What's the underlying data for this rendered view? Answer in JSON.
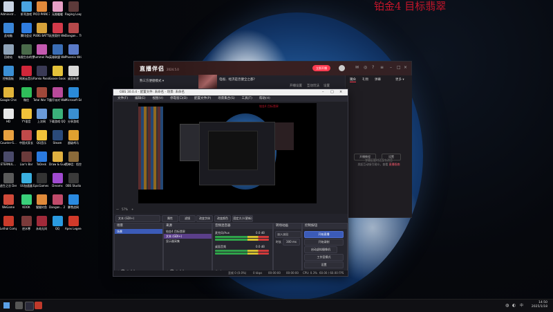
{
  "overlay": {
    "text": "铂金4 目标翡翠"
  },
  "desktop_icons": [
    {
      "label": "Administr...",
      "color": "#c9d4e4",
      "icon": "user-folder-icon"
    },
    {
      "label": "虾壳游戏",
      "color": "#4aa4e0",
      "icon": "game-icon"
    },
    {
      "label": "PICO PARK 3",
      "color": "#e28a3a",
      "icon": "game-icon"
    },
    {
      "label": "无限暖暖",
      "color": "#e7a0c6",
      "icon": "game-icon"
    },
    {
      "label": "Raging Loop",
      "color": "#5c3a3a",
      "icon": "game-icon"
    },
    {
      "label": "此电脑",
      "color": "#3a86d8",
      "icon": "computer-icon"
    },
    {
      "label": "腾讯会议",
      "color": "#2f7de1",
      "icon": "meeting-icon"
    },
    {
      "label": "PUBG BATTLEGR...",
      "color": "#d6a23a",
      "icon": "game-icon"
    },
    {
      "label": "无畏契约 WeGame版",
      "color": "#d33a4a",
      "icon": "game-icon"
    },
    {
      "label": "Dangan... Trigger H...",
      "color": "#b5484a",
      "icon": "game-icon"
    },
    {
      "label": "回收站",
      "color": "#8fa3b8",
      "icon": "recycle-bin-icon"
    },
    {
      "label": "有限生存的世界",
      "color": "#4a6a4a",
      "icon": "game-icon"
    },
    {
      "label": "Pummel Party",
      "color": "#c45ab0",
      "icon": "game-icon"
    },
    {
      "label": "英雄联盟 WeGame版",
      "color": "#3a6db5",
      "icon": "game-icon"
    },
    {
      "label": "Phoenix Wright A...",
      "color": "#5a7ac8",
      "icon": "game-icon"
    },
    {
      "label": "控制面板",
      "color": "#3b8fd4",
      "icon": "control-panel-icon"
    },
    {
      "label": "网易云音乐",
      "color": "#d0273a",
      "icon": "music-icon"
    },
    {
      "label": "Ranko Passion...",
      "color": "#3a3a55",
      "icon": "game-icon"
    },
    {
      "label": "Goose Goose Duck",
      "color": "#e4c23a",
      "icon": "game-icon"
    },
    {
      "label": "桌面新建",
      "color": "#d8d8d8",
      "icon": "file-icon"
    },
    {
      "label": "Google Chrome",
      "color": "#e0b43a",
      "icon": "chrome-icon"
    },
    {
      "label": "微信",
      "color": "#2fbe5a",
      "icon": "wechat-icon"
    },
    {
      "label": "Total War THREE K...",
      "color": "#a0483a",
      "icon": "game-icon"
    },
    {
      "label": "蛋仔派对 Wallpaper...",
      "color": "#b84a9a",
      "icon": "game-icon"
    },
    {
      "label": "Microsoft Edge",
      "color": "#2a8ad8",
      "icon": "edge-icon"
    },
    {
      "label": "HD",
      "color": "#e8e8e8",
      "icon": "file-icon"
    },
    {
      "label": "YY语音",
      "color": "#f0c23a",
      "icon": "voice-icon"
    },
    {
      "label": "上次网",
      "color": "#6a9ad8",
      "icon": "file-icon"
    },
    {
      "label": "下载游戏 QQ音乐",
      "color": "#3ab07a",
      "icon": "music-icon"
    },
    {
      "label": "分享游戏",
      "color": "#3a8fd0",
      "icon": "game-icon"
    },
    {
      "label": "Counter-S...",
      "color": "#e8a040",
      "icon": "game-icon"
    },
    {
      "label": "中国式家长",
      "color": "#c04a4a",
      "icon": "game-icon"
    },
    {
      "label": "QQ音乐",
      "color": "#f0c23a",
      "icon": "music-icon"
    },
    {
      "label": "Steam",
      "color": "#2a4a7a",
      "icon": "steam-icon"
    },
    {
      "label": "超级鸡马",
      "color": "#e0a030",
      "icon": "game-icon"
    },
    {
      "label": "ETERNUL...",
      "color": "#4a4a6a",
      "icon": "game-icon"
    },
    {
      "label": "Liar's Bar",
      "color": "#6a3a3a",
      "icon": "game-icon"
    },
    {
      "label": "ToDesk",
      "color": "#2a7ae0",
      "icon": "remote-desktop-icon"
    },
    {
      "label": "Draw & Guess - ...",
      "color": "#e0b040",
      "icon": "game-icon"
    },
    {
      "label": "黑神话：悟空",
      "color": "#8a6a3a",
      "icon": "game-icon"
    },
    {
      "label": "逃生之谷 Demo",
      "color": "#5a5a5a",
      "icon": "game-icon"
    },
    {
      "label": "UU加速器",
      "color": "#3ab0e0",
      "icon": "accelerator-icon"
    },
    {
      "label": "EpicGames Launcher",
      "color": "#333333",
      "icon": "epic-icon"
    },
    {
      "label": "Dreams",
      "color": "#a04ad0",
      "icon": "game-icon"
    },
    {
      "label": "OBS Studio",
      "color": "#3a3a3a",
      "icon": "obs-icon"
    },
    {
      "label": "WeGame",
      "color": "#d04a3a",
      "icon": "wegame-icon"
    },
    {
      "label": "KOOK",
      "color": "#3ad07a",
      "icon": "chat-icon"
    },
    {
      "label": "猫猫钓鱼",
      "color": "#e08a3a",
      "icon": "game-icon"
    },
    {
      "label": "Dangan... 2 Goodb...",
      "color": "#c04a6a",
      "icon": "game-icon"
    },
    {
      "label": "暴雪战网",
      "color": "#2a8ae0",
      "icon": "battlenet-icon"
    },
    {
      "label": "Lethal Company",
      "color": "#c83a2a",
      "icon": "game-icon"
    },
    {
      "label": "逆水寒",
      "color": "#7a3a3a",
      "icon": "game-icon"
    },
    {
      "label": "永劫无间",
      "color": "#a02a3a",
      "icon": "game-icon"
    },
    {
      "label": "QQ",
      "color": "#2a9ae0",
      "icon": "qq-icon"
    },
    {
      "label": "Apex Legends",
      "color": "#d03a2a",
      "icon": "game-icon"
    }
  ],
  "app": {
    "logo": "直播伴侣",
    "logo_sub": "2024.5.0",
    "start_btn": "立即开播",
    "stream_title": "电视、经济是否健全之都?",
    "room_tag": "熟三方便捷模式 ▾",
    "tabs": [
      "开播设置",
      "互动玩法",
      "设置"
    ],
    "tab_active": "互动",
    "sidebar_tabs": [
      "观众",
      "礼物",
      "弹幕"
    ],
    "sidebar_right": "更多 ▾",
    "empty_line1": "弹幕区暂时还没有消息",
    "empty_line2": "发起互动吸引观众，查看",
    "empty_link": "直播指南",
    "btn_left": "开播教程",
    "btn_right": "设置"
  },
  "obs": {
    "title": "OBS 30.0.4 - 配置文件: 未命名 - 场景: 未命名",
    "menu": [
      "文件(F)",
      "编辑(E)",
      "视图(V)",
      "停靠窗口(D)",
      "配置文件(P)",
      "场景集合(S)",
      "工具(T)",
      "帮助(H)"
    ],
    "toolbar_zoom": "57%",
    "controls": [
      "文本 (GDI+)",
      "属性",
      "滤镜",
      "改变字体",
      "改变颜色",
      "固定大小(更新)"
    ],
    "scenes_header": "场景",
    "scenes": [
      "场景"
    ],
    "sources_header": "来源",
    "sources": [
      "铂金4 目标翡翠",
      "文本 (GDI+)",
      "显示器采集"
    ],
    "mixer_header": "音频混音器",
    "mixer": [
      {
        "name": "麦克风/Aux",
        "db": "0.0 dB"
      },
      {
        "name": "桌面音频",
        "db": "0.0 dB"
      }
    ],
    "transitions_header": "转场动画",
    "transition_type": "淡入淡出",
    "duration_label": "时长",
    "duration": "300 ms",
    "controls_header": "控制按钮",
    "control_buttons": [
      "开始直播",
      "开始录制",
      "启动虚拟摄像机",
      "工作室模式",
      "设置"
    ],
    "status": {
      "frames": "丢帧 0 (0.0%)",
      "bitrate": "0 kbps",
      "time1": "00:00:00",
      "time2": "00:00:00",
      "cpu": "CPU: 0.3%",
      "fps": "60.00 / 60.00 FPS"
    }
  },
  "taskbar": {
    "time": "14:50",
    "date": "2025/1/18",
    "lang": "中"
  }
}
